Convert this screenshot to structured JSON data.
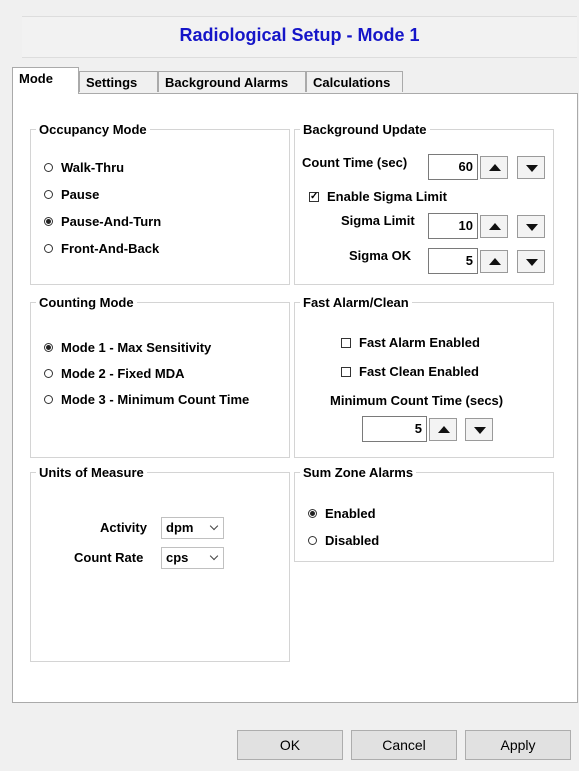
{
  "window": {
    "title": "Radiological Setup - Mode 1"
  },
  "tabs": [
    {
      "label": "Mode",
      "active": true
    },
    {
      "label": "Settings",
      "active": false
    },
    {
      "label": "Background Alarms",
      "active": false
    },
    {
      "label": "Calculations",
      "active": false
    }
  ],
  "occupancy_mode": {
    "legend": "Occupancy Mode",
    "options": [
      "Walk-Thru",
      "Pause",
      "Pause-And-Turn",
      "Front-And-Back"
    ],
    "selected": "Pause-And-Turn"
  },
  "background_update": {
    "legend": "Background Update",
    "count_time_label": "Count Time (sec)",
    "count_time_value": "60",
    "enable_sigma_label": "Enable Sigma Limit",
    "enable_sigma_checked": true,
    "sigma_limit_label": "Sigma Limit",
    "sigma_limit_value": "10",
    "sigma_ok_label": "Sigma OK",
    "sigma_ok_value": "5"
  },
  "counting_mode": {
    "legend": "Counting Mode",
    "options": [
      "Mode 1 - Max Sensitivity",
      "Mode 2 - Fixed MDA",
      "Mode 3 - Minimum Count Time"
    ],
    "selected": "Mode 1 - Max Sensitivity"
  },
  "fast_alarm": {
    "legend": "Fast Alarm/Clean",
    "fast_alarm_label": "Fast Alarm Enabled",
    "fast_alarm_checked": false,
    "fast_clean_label": "Fast Clean Enabled",
    "fast_clean_checked": false,
    "min_count_label": "Minimum Count Time (secs)",
    "min_count_value": "5"
  },
  "units": {
    "legend": "Units of Measure",
    "activity_label": "Activity",
    "activity_value": "dpm",
    "count_rate_label": "Count Rate",
    "count_rate_value": "cps"
  },
  "sum_zone": {
    "legend": "Sum Zone Alarms",
    "options": [
      "Enabled",
      "Disabled"
    ],
    "selected": "Enabled"
  },
  "buttons": {
    "ok": "OK",
    "cancel": "Cancel",
    "apply": "Apply"
  },
  "colors": {
    "title": "#1515c8"
  }
}
